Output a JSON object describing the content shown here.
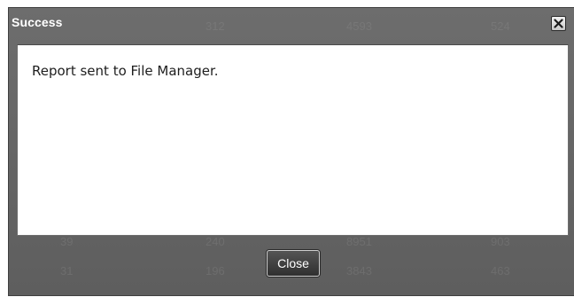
{
  "dialog": {
    "title": "Success",
    "message": "Report sent to File Manager.",
    "close_button_label": "Close",
    "close_icon": "close-icon"
  },
  "background_table": {
    "rows": [
      [
        "",
        "312",
        "4593",
        "524"
      ],
      [
        "39",
        "240",
        "8951",
        "903"
      ],
      [
        "31",
        "196",
        "3843",
        "463"
      ]
    ]
  },
  "colors": {
    "dialog_background": "#646464",
    "content_background": "#ffffff",
    "title_text": "#ffffff",
    "button_background": "#3c3c3c"
  }
}
